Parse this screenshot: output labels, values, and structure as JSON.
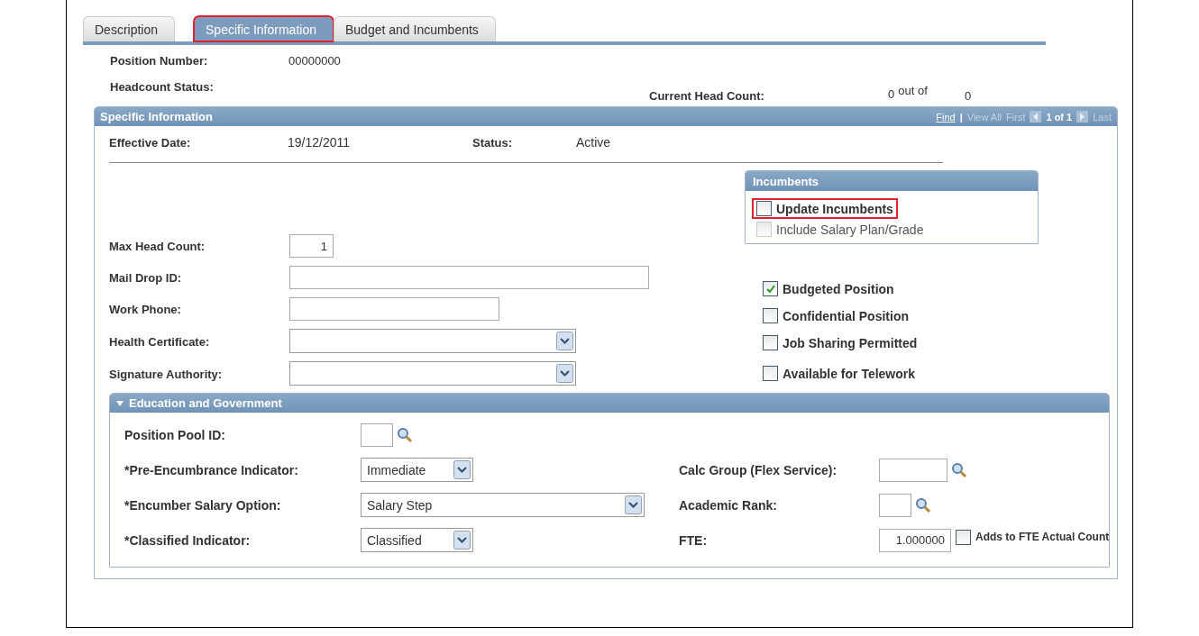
{
  "tabs": [
    {
      "label": "Description",
      "selected": false,
      "highlighted": false
    },
    {
      "label": "Specific Information",
      "selected": true,
      "highlighted": true
    },
    {
      "label": "Budget and Incumbents",
      "selected": false,
      "highlighted": false
    }
  ],
  "header": {
    "position_number": {
      "label": "Position Number:",
      "value": "00000000"
    },
    "headcount_status": {
      "label": "Headcount Status:"
    },
    "current_head_count": {
      "label": "Current Head Count:",
      "value": "0",
      "out_of": "out of",
      "total": "0"
    }
  },
  "specific_panel": {
    "title": "Specific Information",
    "nav": {
      "find": "Find",
      "separator": "|",
      "view_all": "View All",
      "first": "First",
      "count": "1 of 1",
      "last": "Last"
    },
    "effective_date": {
      "label": "Effective Date:",
      "value": "19/12/2011"
    },
    "status": {
      "label": "Status:",
      "value": "Active"
    },
    "fields": [
      {
        "kind": "number",
        "label": "Max Head Count:",
        "value": "1"
      },
      {
        "kind": "long",
        "label": "Mail Drop ID:"
      },
      {
        "kind": "medium",
        "label": "Work Phone:"
      },
      {
        "kind": "select",
        "label": "Health Certificate:"
      },
      {
        "kind": "select",
        "label": "Signature Authority:"
      }
    ],
    "incumbents": {
      "title": "Incumbents",
      "options": [
        {
          "label": "Update Incumbents",
          "checked": false,
          "disabled": false,
          "highlighted": true
        },
        {
          "label": "Include Salary Plan/Grade",
          "checked": false,
          "disabled": true,
          "highlighted": false
        }
      ]
    },
    "checkboxes": [
      {
        "label": "Budgeted Position",
        "checked": true
      },
      {
        "label": "Confidential Position",
        "checked": false
      },
      {
        "label": "Job Sharing Permitted",
        "checked": false
      },
      {
        "label": "Available for Telework",
        "checked": false
      }
    ],
    "education_panel": {
      "title": "Education and Government",
      "expanded": true,
      "rows": [
        {
          "left": {
            "kind": "lookup",
            "label": "Position Pool ID:"
          }
        },
        {
          "left": {
            "kind": "dropdown",
            "label": "*Pre-Encumbrance Indicator:",
            "value": "Immediate"
          },
          "right": {
            "kind": "widelookup",
            "label": "Calc Group (Flex Service):"
          }
        },
        {
          "left": {
            "kind": "longdropdown",
            "label": "*Encumber Salary Option:",
            "value": "Salary Step"
          },
          "right": {
            "kind": "lookup",
            "label": "Academic Rank:"
          }
        },
        {
          "left": {
            "kind": "dropdown",
            "label": "*Classified Indicator:",
            "value": "Classified"
          },
          "right": {
            "kind": "number",
            "label": "FTE:",
            "value": "1.000000",
            "checkbox": {
              "label": "Adds to FTE Actual Count",
              "checked": false
            }
          }
        }
      ]
    }
  }
}
